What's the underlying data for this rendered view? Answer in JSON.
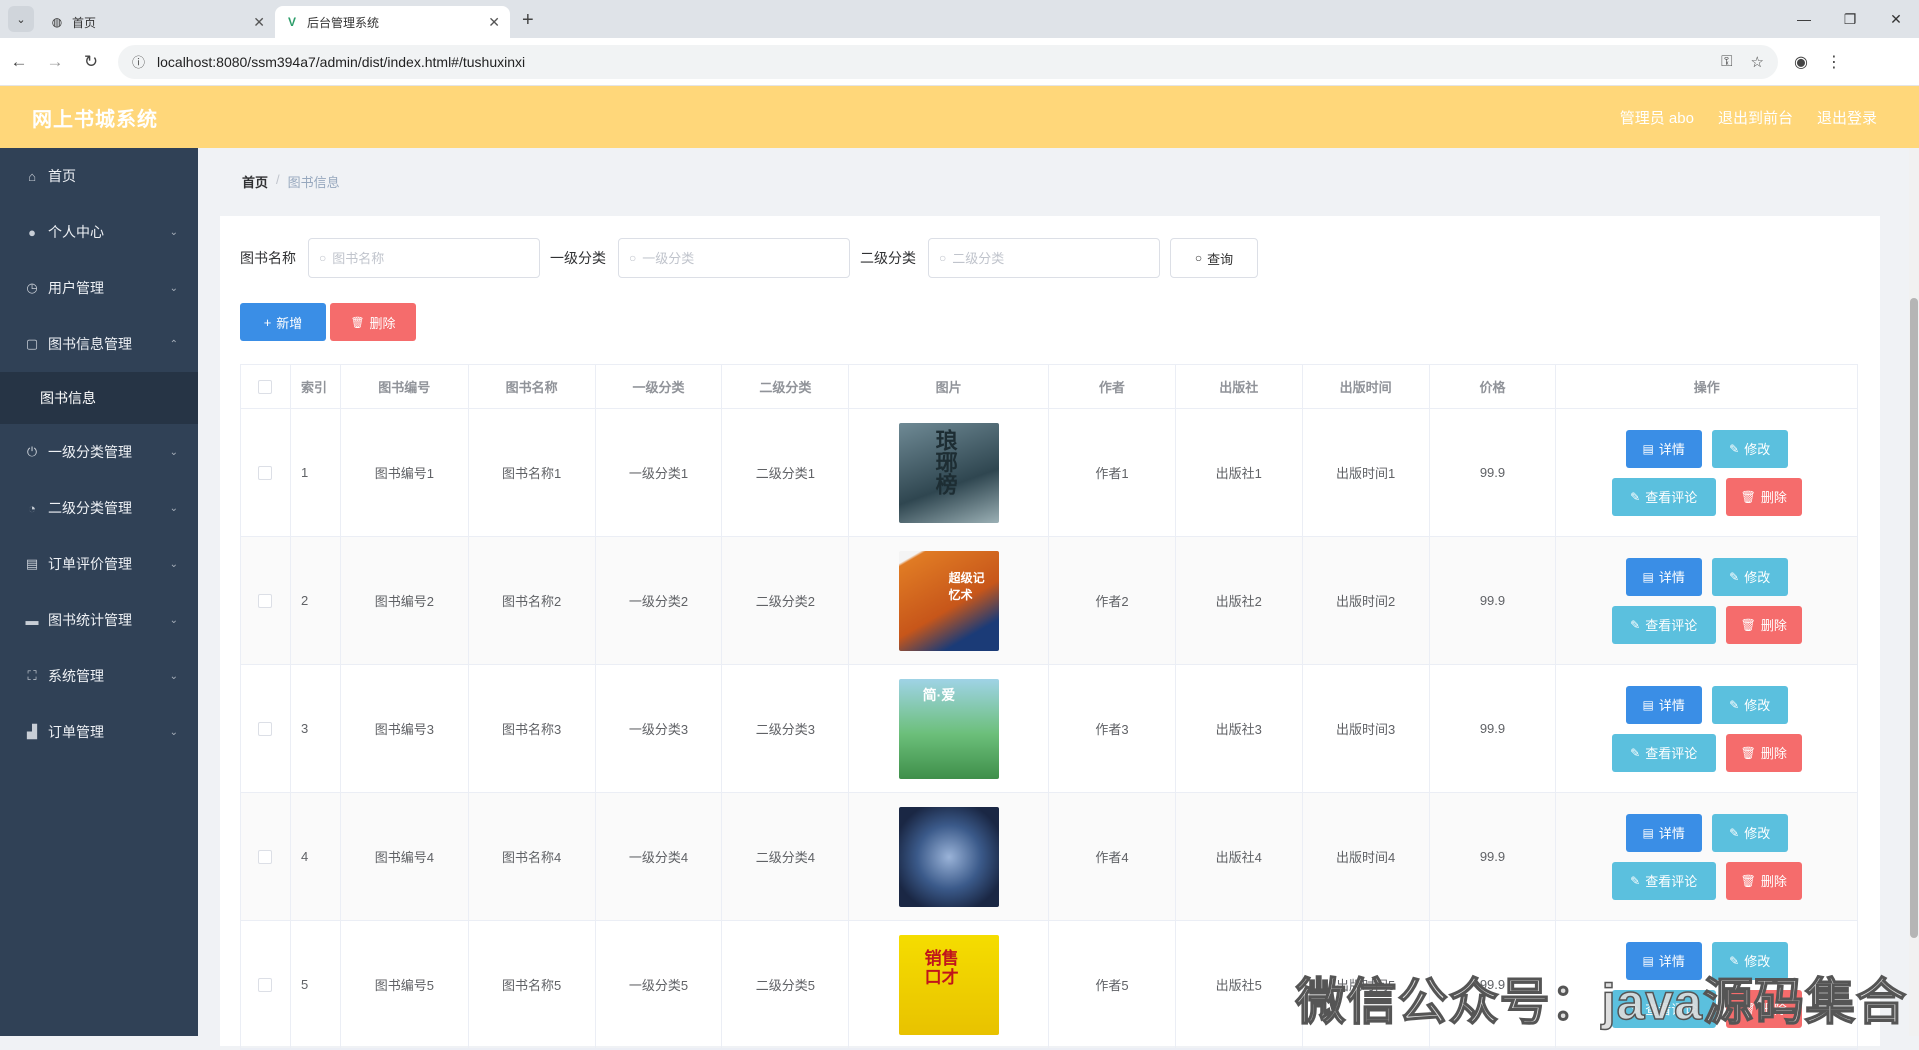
{
  "browser": {
    "tabs": [
      {
        "title": "首页",
        "favicon": "globe-icon",
        "active": false
      },
      {
        "title": "后台管理系统",
        "favicon": "vue-icon",
        "active": true
      }
    ],
    "url": "localhost:8080/ssm394a7/admin/dist/index.html#/tushuxinxi"
  },
  "header": {
    "title": "网上书城系统",
    "links": [
      "管理员 abo",
      "退出到前台",
      "退出登录"
    ],
    "bg_color": "#ffd77a"
  },
  "sidebar": {
    "items": [
      {
        "label": "首页",
        "icon": "home-icon",
        "arrow": ""
      },
      {
        "label": "个人中心",
        "icon": "user-icon",
        "arrow": "⌄"
      },
      {
        "label": "用户管理",
        "icon": "compass-icon",
        "arrow": "⌄"
      },
      {
        "label": "图书信息管理",
        "icon": "frame-icon",
        "arrow": "⌃"
      },
      {
        "label": "图书信息",
        "sub": true
      },
      {
        "label": "一级分类管理",
        "icon": "power-icon",
        "arrow": "⌄"
      },
      {
        "label": "二级分类管理",
        "icon": "gauge-icon",
        "arrow": "⌄"
      },
      {
        "label": "订单评价管理",
        "icon": "doc-icon",
        "arrow": "⌄"
      },
      {
        "label": "图书统计管理",
        "icon": "card-icon",
        "arrow": "⌄"
      },
      {
        "label": "系统管理",
        "icon": "fullscreen-icon",
        "arrow": "⌄"
      },
      {
        "label": "订单管理",
        "icon": "cart-icon",
        "arrow": "⌄"
      }
    ]
  },
  "breadcrumb": {
    "home": "首页",
    "sep": "/",
    "current": "图书信息"
  },
  "search": {
    "name_label": "图书名称",
    "name_placeholder": "图书名称",
    "c1_label": "一级分类",
    "c1_placeholder": "一级分类",
    "c2_label": "二级分类",
    "c2_placeholder": "二级分类",
    "query_label": "查询"
  },
  "actions": {
    "add_label": "新增",
    "delete_label": "删除"
  },
  "table": {
    "headers": [
      "索引",
      "图书编号",
      "图书名称",
      "一级分类",
      "二级分类",
      "图片",
      "作者",
      "出版社",
      "出版时间",
      "价格",
      "操作"
    ],
    "rows": [
      {
        "idx": "1",
        "code": "图书编号1",
        "name": "图书名称1",
        "c1": "一级分类1",
        "c2": "二级分类1",
        "author": "作者1",
        "pub": "出版社1",
        "time": "出版时间1",
        "price": "99.9",
        "cover_text": "琅琊榜",
        "cover": "cover-1"
      },
      {
        "idx": "2",
        "code": "图书编号2",
        "name": "图书名称2",
        "c1": "一级分类2",
        "c2": "二级分类2",
        "author": "作者2",
        "pub": "出版社2",
        "time": "出版时间2",
        "price": "99.9",
        "cover_text": "超级记忆术",
        "cover": "cover-2"
      },
      {
        "idx": "3",
        "code": "图书编号3",
        "name": "图书名称3",
        "c1": "一级分类3",
        "c2": "二级分类3",
        "author": "作者3",
        "pub": "出版社3",
        "time": "出版时间3",
        "price": "99.9",
        "cover_text": "简·爱",
        "cover": "cover-3"
      },
      {
        "idx": "4",
        "code": "图书编号4",
        "name": "图书名称4",
        "c1": "一级分类4",
        "c2": "二级分类4",
        "author": "作者4",
        "pub": "出版社4",
        "time": "出版时间4",
        "price": "99.9",
        "cover_text": "",
        "cover": "cover-4"
      },
      {
        "idx": "5",
        "code": "图书编号5",
        "name": "图书名称5",
        "c1": "一级分类5",
        "c2": "二级分类5",
        "author": "作者5",
        "pub": "出版社5",
        "time": "出版时间5",
        "price": "99.9",
        "cover_text": "销售口才",
        "cover": "cover-5"
      }
    ],
    "ops": {
      "detail": "详情",
      "edit": "修改",
      "comment": "查看评论",
      "remove": "删除"
    }
  },
  "watermark": "微信公众号：java源码集合"
}
